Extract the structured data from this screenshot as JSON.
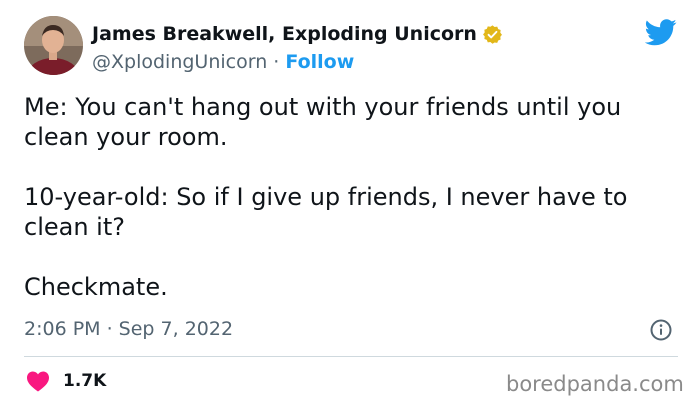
{
  "author": {
    "display_name": "James Breakwell, Exploding Unicorn",
    "handle": "@XplodingUnicorn",
    "separator": "·",
    "follow_label": "Follow"
  },
  "icons": {
    "verified": "verified-badge-icon",
    "logo": "twitter-bird-icon",
    "info": "info-icon",
    "like": "heart-icon"
  },
  "tweet": {
    "lines": [
      "Me: You can't hang out with your friends until you clean your room.",
      "10-year-old: So if I give up friends, I never have to clean it?",
      "Checkmate."
    ]
  },
  "meta": {
    "timestamp": "2:06 PM · Sep 7, 2022"
  },
  "engagement": {
    "likes": "1.7K"
  },
  "watermark": "boredpanda.com",
  "colors": {
    "accent": "#1d9bf0",
    "verified": "#e2b719",
    "heart": "#f91880",
    "muted": "#536471"
  }
}
